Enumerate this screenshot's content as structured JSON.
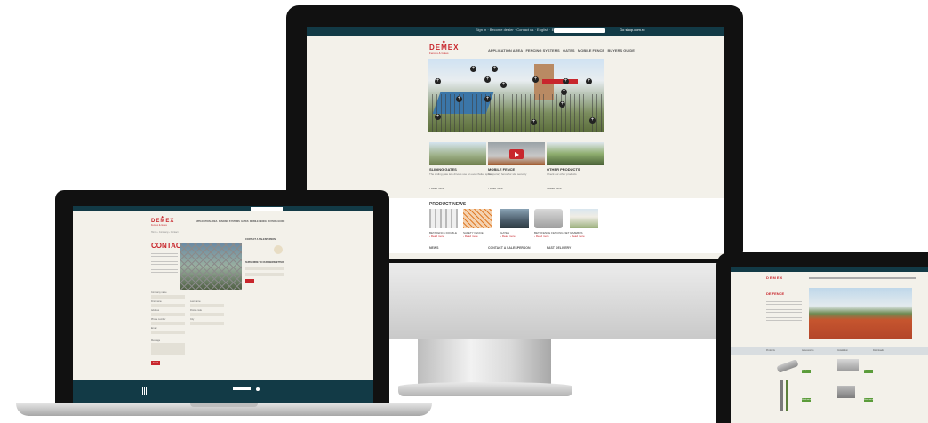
{
  "brand": {
    "name": "DEMEX",
    "tagline": "Fences & Gates",
    "accent": "#c8262c",
    "dark": "#123a46"
  },
  "imac": {
    "topbar": {
      "links": "Sign in  ·  Become dealer  ·  Contact us  ·  English  ·  EUR",
      "shop": "Go shop.com.ro"
    },
    "nav": [
      "APPLICATION AREA",
      "FENCING SYSTEMS",
      "GATES",
      "MOBILE FENCE",
      "BUYERS GUIDE"
    ],
    "hero_dots": 5,
    "promos": [
      {
        "title": "SLIDING GATES",
        "text": "The sliding gate lets drivers use an even flatter space",
        "more": "› Read more"
      },
      {
        "title": "MOBILE FENCE",
        "text": "Temporary fence for site security",
        "more": "› Read more"
      },
      {
        "title": "OTHER PRODUCTS",
        "text": "Check our other products",
        "more": "› Read more"
      }
    ],
    "product_news_title": "PRODUCT NEWS",
    "product_news": [
      {
        "label": "BETAFENCE DOUBLE",
        "more": "› Read more"
      },
      {
        "label": "SAFETY FENCE",
        "more": "› Read more"
      },
      {
        "label": "GATES",
        "more": "› Read more"
      },
      {
        "label": "BETOFENCE FENCING NET",
        "more": "› Read more"
      },
      {
        "label": "GAZEBOS",
        "more": "› Read more"
      }
    ],
    "footer_cols": [
      "NEWS",
      "CONTACT A SALESPERSON",
      "FAST DELIVERY"
    ]
  },
  "macbook": {
    "nav": [
      "APPLICATION AREA",
      "FENCING SYSTEMS",
      "GATES",
      "MOBILE FENCE",
      "BUYERS GUIDE"
    ],
    "breadcrumb": "Home  ›  Company  ›  Contact",
    "contact_title": "CONTACT SUPPORT",
    "side_title": "CONTACT A SALESPERSON",
    "newsletter_title": "SUBSCRIBE TO OUR NEWSLETTER",
    "form_labels": [
      "Company name",
      "First name",
      "Last name",
      "Address",
      "Postal code",
      "Phone number",
      "City",
      "Email",
      "Message"
    ],
    "send": "Send"
  },
  "ipad": {
    "hero_title": "DE FENCE",
    "tabs": [
      "Products",
      "Accessories",
      "Installation",
      "Downloads"
    ],
    "buttons": [
      "Read more",
      "Read more",
      "Read more",
      "Read more"
    ]
  }
}
